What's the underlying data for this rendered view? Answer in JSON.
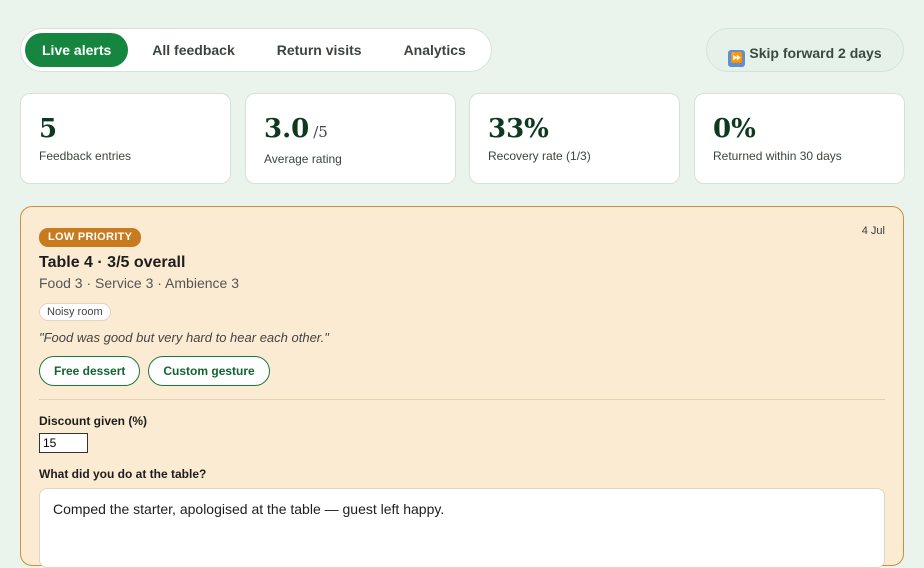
{
  "nav": {
    "tabs": [
      {
        "label": "Live alerts",
        "active": true
      },
      {
        "label": "All feedback",
        "active": false
      },
      {
        "label": "Return visits",
        "active": false
      },
      {
        "label": "Analytics",
        "active": false
      }
    ],
    "skip_button": {
      "icon": "fast-forward-icon",
      "label": "Skip forward 2 days"
    }
  },
  "stats": [
    {
      "value": "5",
      "suffix": "",
      "label": "Feedback entries"
    },
    {
      "value": "3.0",
      "suffix": "/5",
      "label": "Average rating"
    },
    {
      "value": "33%",
      "suffix": "",
      "label": "Recovery rate (1/3)"
    },
    {
      "value": "0%",
      "suffix": "",
      "label": "Returned within 30 days"
    }
  ],
  "alert": {
    "priority": "LOW PRIORITY",
    "date": "4 Jul",
    "title": "Table 4 · 3/5 overall",
    "subtitle": "Food 3 · Service 3 · Ambience 3",
    "tag": "Noisy room",
    "quote": "\"Food was good but very hard to hear each other.\"",
    "actions": [
      "Free dessert",
      "Custom gesture"
    ],
    "discount_label": "Discount given (%)",
    "discount_value": "15",
    "note_label": "What did you do at the table?",
    "note_value": "Comped the starter, apologised at the table — guest left happy."
  },
  "colors": {
    "accent": "#15853f",
    "background": "#eaf4ec",
    "card_low_priority": "#fbebd3",
    "badge_low_priority": "#c87a1f"
  }
}
